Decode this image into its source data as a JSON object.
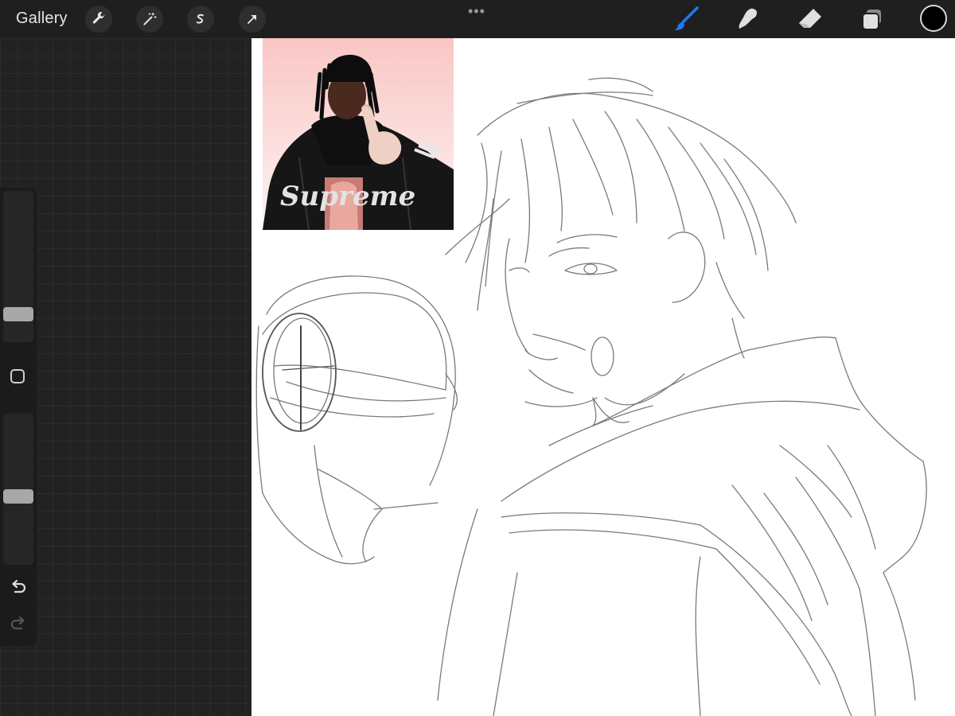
{
  "toolbar": {
    "gallery_label": "Gallery",
    "more_indicator": "•••",
    "left_tools": [
      "wrench-icon",
      "magic-wand-icon",
      "selection-icon",
      "transform-arrow-icon"
    ],
    "right_tools": [
      "brush-icon",
      "smudge-icon",
      "eraser-icon",
      "layers-icon"
    ],
    "active_tool": "brush",
    "active_tool_color": "#1e7bf2",
    "current_color": "#000000"
  },
  "sidebar": {
    "brush_size_level": 0.15,
    "opacity_level": 0.45,
    "icons": [
      "modifier-square-icon",
      "undo-icon",
      "redo-icon"
    ]
  },
  "canvas": {
    "background": "#ffffff",
    "reference_image": "photo of person with dreadlocks in black varsity jacket pointing up",
    "reference_jacket_text": "Supreme",
    "sketch": "pencil line drawing of person in hoodie with raised fist"
  }
}
